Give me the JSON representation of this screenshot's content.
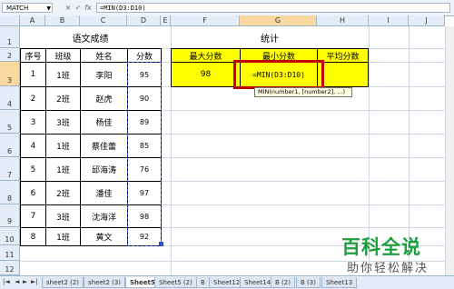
{
  "formula_bar": {
    "name_box": "MATCH",
    "cancel_icon": "×",
    "enter_icon": "✓",
    "fx_label": "fx",
    "formula": "=MIN(D3:D10)"
  },
  "columns": [
    "A",
    "B",
    "C",
    "D",
    "E",
    "F",
    "G",
    "H",
    "I",
    "J"
  ],
  "rows": [
    "1",
    "2",
    "3",
    "4",
    "5",
    "6",
    "7",
    "8",
    "9",
    "10",
    "11",
    "12"
  ],
  "score_table": {
    "title": "语文成绩",
    "headers": [
      "序号",
      "班级",
      "姓名",
      "分数"
    ],
    "rows": [
      [
        "1",
        "1班",
        "李阳",
        "95"
      ],
      [
        "2",
        "2班",
        "赵虎",
        "90"
      ],
      [
        "3",
        "3班",
        "杨佳",
        "89"
      ],
      [
        "4",
        "1班",
        "蔡佳蕾",
        "85"
      ],
      [
        "5",
        "1班",
        "邱海涛",
        "76"
      ],
      [
        "6",
        "2班",
        "潘佳",
        "97"
      ],
      [
        "7",
        "3班",
        "沈海洋",
        "98"
      ],
      [
        "8",
        "1班",
        "黄文",
        "92"
      ]
    ]
  },
  "stats": {
    "title": "统计",
    "headers": [
      "最大分数",
      "最小分数",
      "平均分数"
    ],
    "values": [
      "98",
      "=MIN(D3:D10)",
      ""
    ]
  },
  "tooltip": "MIN(number1, [number2], ...)",
  "sheet_tabs": [
    "sheet2 (2)",
    "sheet2 (3)",
    "Sheet5",
    "Sheet5 (2)",
    "B",
    "Sheet12",
    "Sheet14",
    "B (2)",
    "B (3)",
    "Sheet13"
  ],
  "active_tab": "Sheet5",
  "watermark": {
    "line1": "百科全说",
    "line2": "助你轻松解决"
  },
  "colors": {
    "highlight": "#ffff00",
    "selection_border": "#c00000",
    "header_bg": "#e4ecf7"
  }
}
